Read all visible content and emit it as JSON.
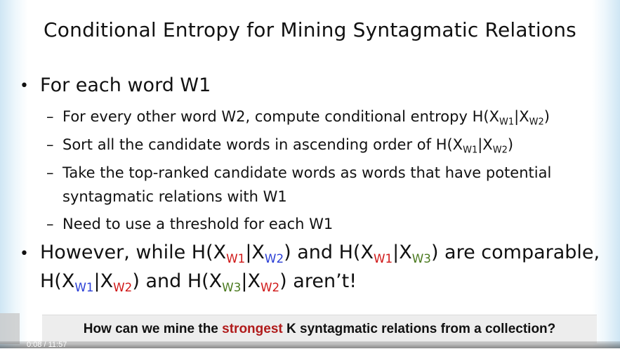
{
  "slide": {
    "title": "Conditional Entropy for Mining Syntagmatic Relations",
    "bullet_marker": "•",
    "dash_marker": "–",
    "point1": "For each word W1",
    "sub1": {
      "pre": "For every other word W2, compute conditional entropy H(X",
      "s1": "W1",
      "mid": "|X",
      "s2": "W2",
      "post": ")"
    },
    "sub2": {
      "pre": "Sort all the candidate words in ascending order of H(X",
      "s1": "W1",
      "mid": "|X",
      "s2": "W2",
      "post": ")"
    },
    "sub3_line1": "Take the top-ranked candidate words as words that have potential",
    "sub3_line2": "syntagmatic relations with W1",
    "sub4": "Need to use a threshold for each W1",
    "point2": {
      "a": "However, while H(X",
      "a_s1": "W1",
      "a_mid": "|X",
      "a_s2": "W2",
      "b": ") and H(X",
      "b_s1": "W1",
      "b_mid": "|X",
      "b_s2": "W3",
      "c": ") are comparable,",
      "d": "H(X",
      "d_s1": "W1",
      "d_mid": "|X",
      "d_s2": "W2",
      "e": ") and H(X",
      "e_s1": "W3",
      "e_mid": "|X",
      "e_s2": "W2",
      "f": ") aren’t!"
    }
  },
  "banner": {
    "pre": "How can we mine the ",
    "highlight": "strongest",
    "post": " K syntagmatic relations from a collection?"
  },
  "player": {
    "current_time": "0:08",
    "separator": "/",
    "duration": "11:57"
  },
  "colors": {
    "blue": "#2b3fd6",
    "red": "#d01818",
    "green": "#4b7a1f",
    "banner_highlight": "#b01b1b"
  }
}
